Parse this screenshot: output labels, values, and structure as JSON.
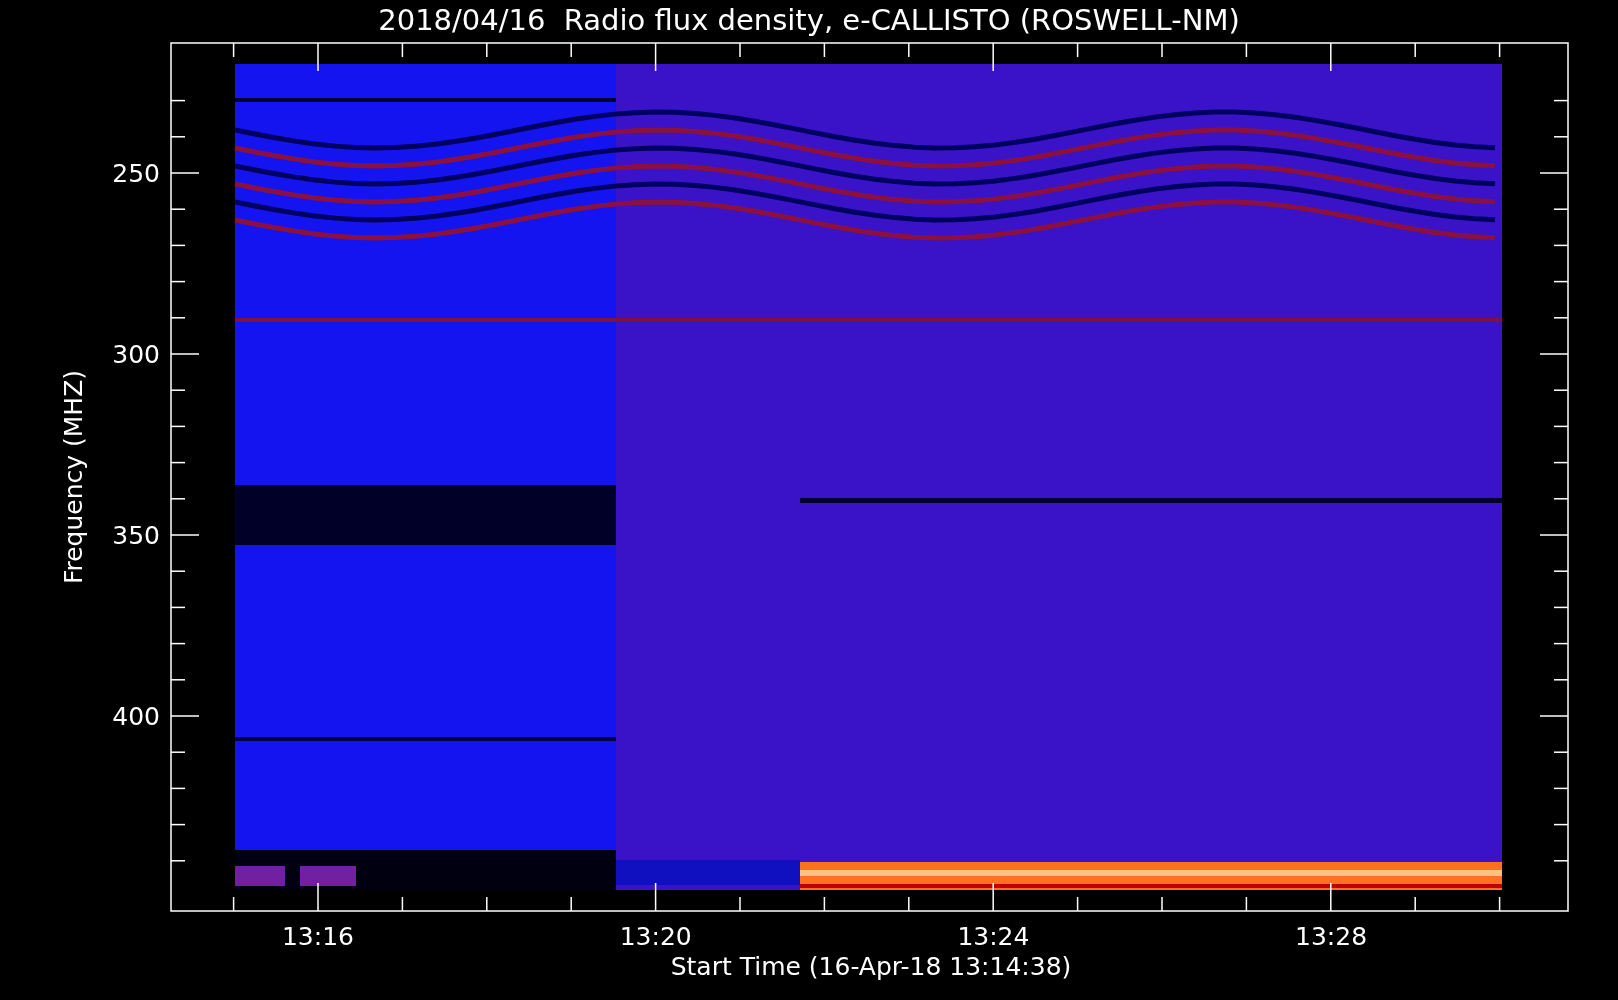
{
  "title": "2018/04/16  Radio flux density, e-CALLISTO (ROSWELL-NM)",
  "y_axis": {
    "label": "Frequency (MHZ)",
    "ticks": [
      "250",
      "300",
      "350",
      "400"
    ]
  },
  "x_axis": {
    "label": "Start Time (16-Apr-18 13:14:38)",
    "ticks": [
      "13:16",
      "13:20",
      "13:24",
      "13:28"
    ]
  }
}
